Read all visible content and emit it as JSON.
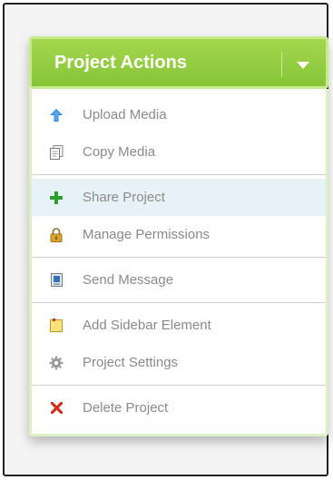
{
  "dropdown": {
    "title": "Project Actions",
    "caret_icon": "chevron-down-icon",
    "header_color": "#8cc63f"
  },
  "menu": {
    "groups": [
      {
        "items": [
          {
            "label": "Upload Media",
            "icon": "upload-arrow-icon"
          },
          {
            "label": "Copy Media",
            "icon": "copy-document-icon"
          }
        ]
      },
      {
        "items": [
          {
            "label": "Share Project",
            "icon": "green-plus-icon",
            "active": true
          },
          {
            "label": "Manage Permissions",
            "icon": "lock-icon"
          }
        ]
      },
      {
        "items": [
          {
            "label": "Send Message",
            "icon": "message-card-icon"
          }
        ]
      },
      {
        "items": [
          {
            "label": "Add Sidebar Element",
            "icon": "note-icon"
          },
          {
            "label": "Project Settings",
            "icon": "gear-icon"
          }
        ]
      },
      {
        "items": [
          {
            "label": "Delete Project",
            "icon": "red-x-icon"
          }
        ]
      }
    ]
  }
}
